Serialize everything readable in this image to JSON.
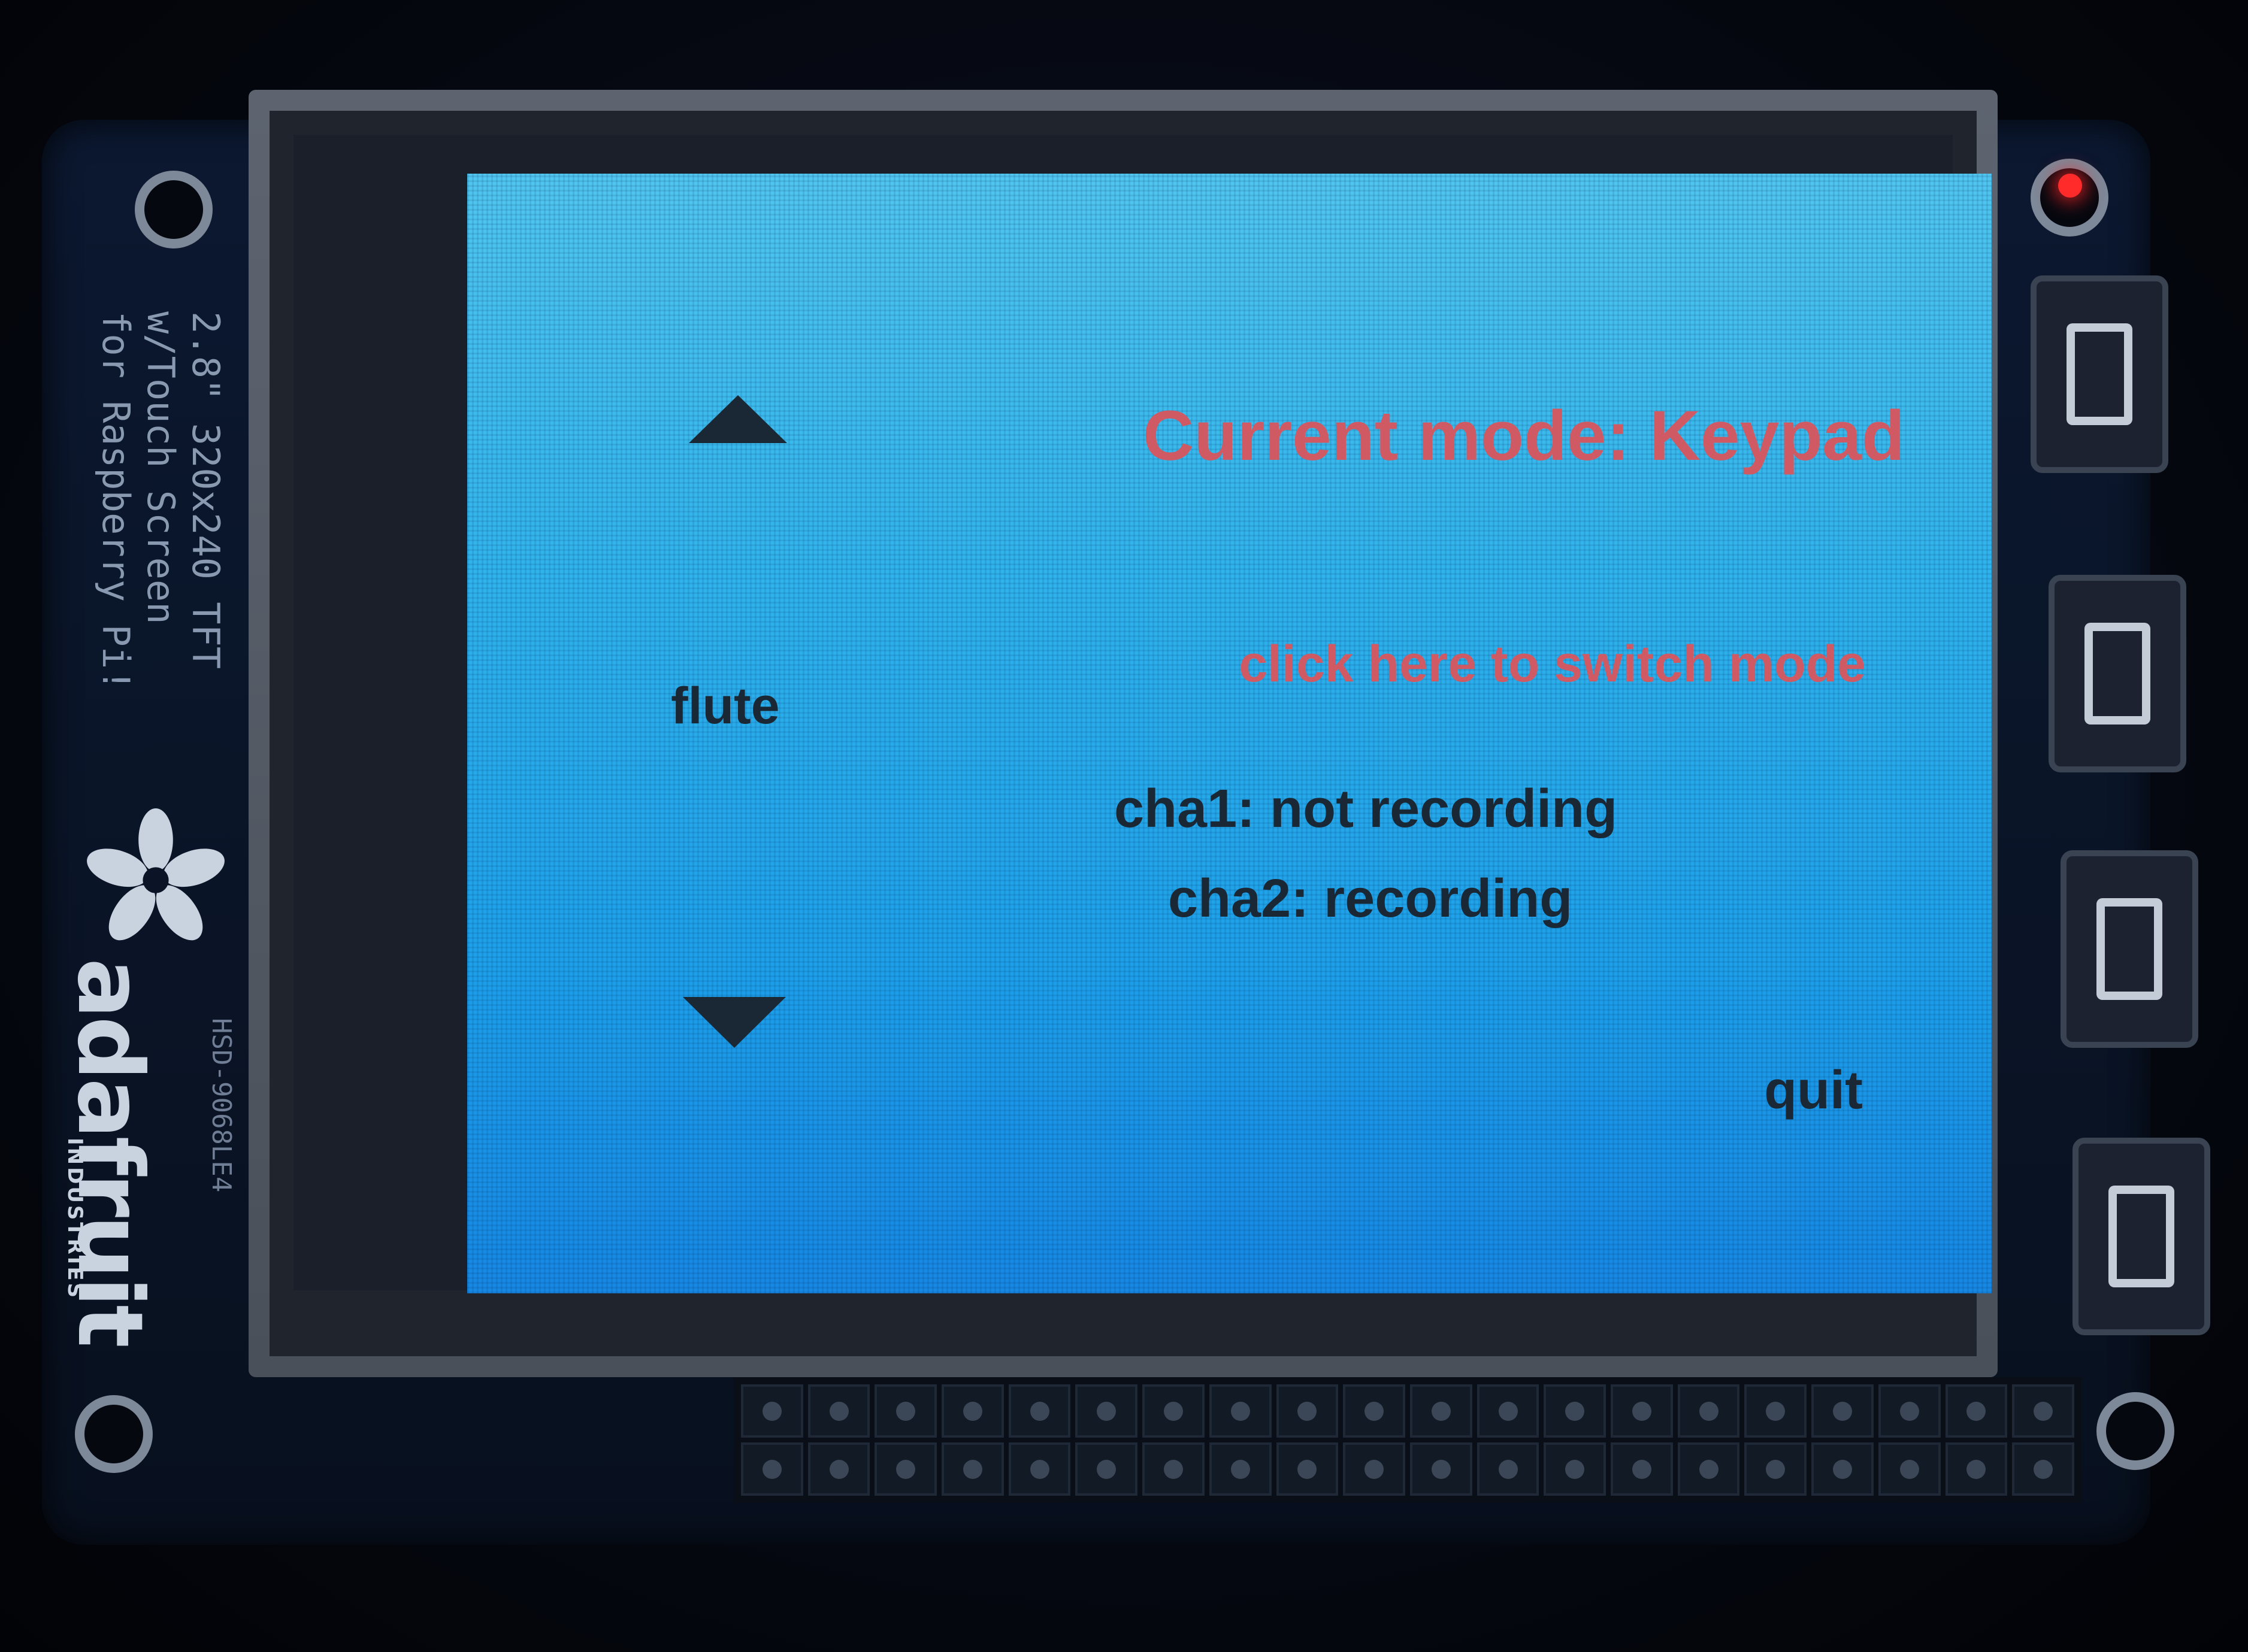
{
  "board": {
    "silkscreen_lines": [
      "2.8\" 320x240 TFT",
      "w/Touch Screen",
      "for Raspberry Pi!"
    ],
    "brand": "adafruit",
    "brand_sub": "INDUSTRIES",
    "model": "HSD-9068LE4"
  },
  "screen": {
    "mode_title": "Current mode: Keypad",
    "switch_mode_label": "click here to switch mode",
    "instrument_label": "flute",
    "cha1_status": "cha1: not recording",
    "cha2_status": "cha2: recording",
    "quit_label": "quit",
    "up_icon": "triangle-up",
    "down_icon": "triangle-down"
  },
  "colors": {
    "screen_background": "#2fb4ec",
    "accent_text": "#d05a64",
    "primary_text": "#1a2836"
  }
}
